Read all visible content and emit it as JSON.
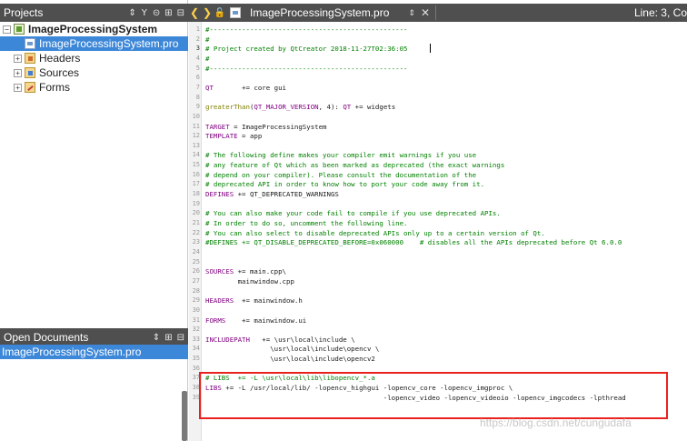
{
  "projects_pane": {
    "title": "Projects",
    "tools": [
      "⇕",
      "Y",
      "⊝",
      "⊞",
      "⊟"
    ]
  },
  "tree": {
    "project": "ImageProcessingSystem",
    "pro_file": "ImageProcessingSystem.pro",
    "headers": "Headers",
    "sources": "Sources",
    "forms": "Forms"
  },
  "open_docs_pane": {
    "title": "Open Documents",
    "tools": [
      "⇕",
      "⊞",
      "⊟"
    ],
    "items": [
      "ImageProcessingSystem.pro"
    ]
  },
  "editor_bar": {
    "back_icon": "arrow-left-icon",
    "forward_icon": "arrow-right-icon",
    "file_name": "ImageProcessingSystem.pro",
    "line_info": "Line: 3, Co"
  },
  "code_lines": [
    {
      "n": "1",
      "text": "#-------------------------------------------------",
      "cls": "c-comment"
    },
    {
      "n": "2",
      "text": "#",
      "cls": "c-comment"
    },
    {
      "n": "3",
      "text": "# Project created by QtCreator 2018-11-27T02:36:05",
      "cls": "c-comment"
    },
    {
      "n": "4",
      "text": "#",
      "cls": "c-comment"
    },
    {
      "n": "5",
      "text": "#-------------------------------------------------",
      "cls": "c-comment"
    },
    {
      "n": "6",
      "text": "",
      "cls": ""
    },
    {
      "n": "7",
      "text": "QT       += core gui",
      "cls": "qt"
    },
    {
      "n": "8",
      "text": "",
      "cls": ""
    },
    {
      "n": "9",
      "text": "greaterThan(QT_MAJOR_VERSION, 4): QT += widgets",
      "cls": "gt"
    },
    {
      "n": "10",
      "text": "",
      "cls": ""
    },
    {
      "n": "11",
      "text": "TARGET = ImageProcessingSystem",
      "cls": "kw"
    },
    {
      "n": "12",
      "text": "TEMPLATE = app",
      "cls": "kw"
    },
    {
      "n": "13",
      "text": "",
      "cls": ""
    },
    {
      "n": "14",
      "text": "# The following define makes your compiler emit warnings if you use",
      "cls": "c-comment"
    },
    {
      "n": "15",
      "text": "# any feature of Qt which as been marked as deprecated (the exact warnings",
      "cls": "c-comment"
    },
    {
      "n": "16",
      "text": "# depend on your compiler). Please consult the documentation of the",
      "cls": "c-comment"
    },
    {
      "n": "17",
      "text": "# deprecated API in order to know how to port your code away from it.",
      "cls": "c-comment"
    },
    {
      "n": "18",
      "text": "DEFINES += QT_DEPRECATED_WARNINGS",
      "cls": "kw"
    },
    {
      "n": "19",
      "text": "",
      "cls": ""
    },
    {
      "n": "20",
      "text": "# You can also make your code fail to compile if you use deprecated APIs.",
      "cls": "c-comment"
    },
    {
      "n": "21",
      "text": "# In order to do so, uncomment the following line.",
      "cls": "c-comment"
    },
    {
      "n": "22",
      "text": "# You can also select to disable deprecated APIs only up to a certain version of Qt.",
      "cls": "c-comment"
    },
    {
      "n": "23",
      "text": "#DEFINES += QT_DISABLE_DEPRECATED_BEFORE=0x060000    # disables all the APIs deprecated before Qt 6.0.0",
      "cls": "c-comment"
    },
    {
      "n": "24",
      "text": "",
      "cls": ""
    },
    {
      "n": "25",
      "text": "",
      "cls": ""
    },
    {
      "n": "26",
      "text": "SOURCES += main.cpp\\",
      "cls": "kw"
    },
    {
      "n": "27",
      "text": "        mainwindow.cpp",
      "cls": ""
    },
    {
      "n": "28",
      "text": "",
      "cls": ""
    },
    {
      "n": "29",
      "text": "HEADERS  += mainwindow.h",
      "cls": "kw"
    },
    {
      "n": "30",
      "text": "",
      "cls": ""
    },
    {
      "n": "31",
      "text": "FORMS    += mainwindow.ui",
      "cls": "kw"
    },
    {
      "n": "32",
      "text": "",
      "cls": ""
    },
    {
      "n": "33",
      "text": "INCLUDEPATH   += \\usr\\local\\include \\",
      "cls": "kw"
    },
    {
      "n": "34",
      "text": "                \\usr\\local\\include\\opencv \\",
      "cls": ""
    },
    {
      "n": "35",
      "text": "                \\usr\\local\\include\\opencv2",
      "cls": ""
    },
    {
      "n": "36",
      "text": "",
      "cls": ""
    },
    {
      "n": "37",
      "text": "# LIBS  += -L \\usr\\local\\lib\\libopencv_*.a",
      "cls": "c-comment"
    },
    {
      "n": "38",
      "text": "LIBS += -L /usr/local/lib/ -lopencv_highgui -lopencv_core -lopencv_imgproc \\",
      "cls": "kw"
    },
    {
      "n": "39",
      "text": "                                            -lopencv_video -lopencv_videoio -lopencv_imgcodecs -lpthread",
      "cls": ""
    }
  ],
  "watermark": "https://blog.csdn.net/cungudafa",
  "colors": {
    "header_bg": "#4f4f4f",
    "selection": "#3d87d8",
    "comment": "#008000",
    "keyword": "#800080",
    "highlight_box": "#e8231f"
  }
}
